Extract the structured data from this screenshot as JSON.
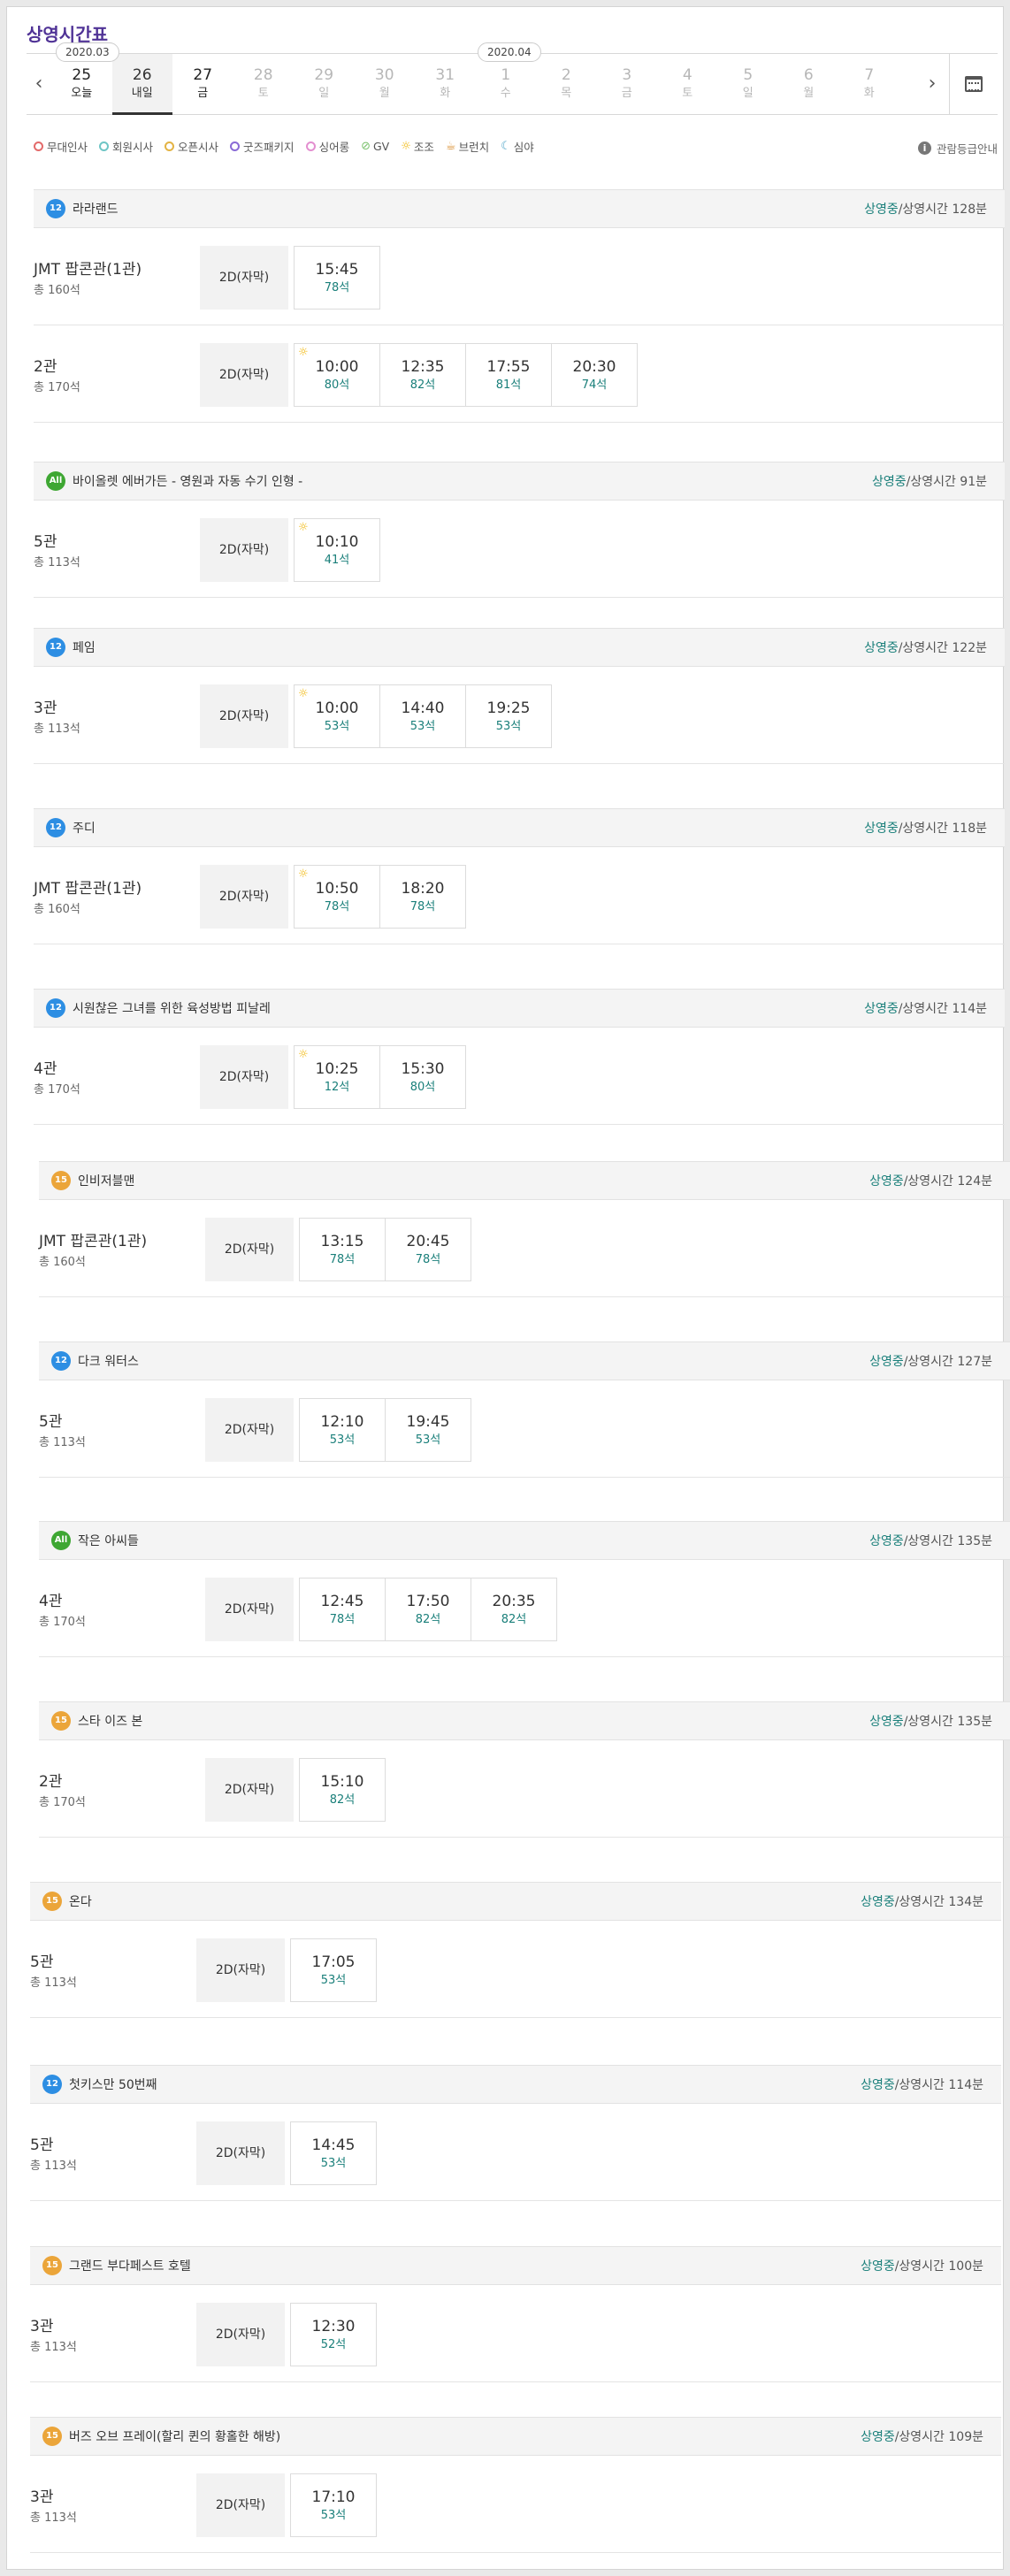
{
  "page_title": "상영시간표",
  "date_nav": {
    "prev_label": "‹",
    "next_label": "›",
    "month_tags": [
      "2020.03",
      "2020.04"
    ],
    "days": [
      {
        "num": "25",
        "weekday": "오늘",
        "state": "on"
      },
      {
        "num": "26",
        "weekday": "내일",
        "state": "sel"
      },
      {
        "num": "27",
        "weekday": "금",
        "state": "on"
      },
      {
        "num": "28",
        "weekday": "토",
        "state": "off"
      },
      {
        "num": "29",
        "weekday": "일",
        "state": "off"
      },
      {
        "num": "30",
        "weekday": "월",
        "state": "off"
      },
      {
        "num": "31",
        "weekday": "화",
        "state": "off"
      },
      {
        "num": "1",
        "weekday": "수",
        "state": "off"
      },
      {
        "num": "2",
        "weekday": "목",
        "state": "off"
      },
      {
        "num": "3",
        "weekday": "금",
        "state": "off"
      },
      {
        "num": "4",
        "weekday": "토",
        "state": "off"
      },
      {
        "num": "5",
        "weekday": "일",
        "state": "off"
      },
      {
        "num": "6",
        "weekday": "월",
        "state": "off"
      },
      {
        "num": "7",
        "weekday": "화",
        "state": "off"
      }
    ]
  },
  "legend": [
    {
      "label": "무대인사",
      "color": "#e36a6a",
      "kind": "dot"
    },
    {
      "label": "회원시사",
      "color": "#6ec5c5",
      "kind": "dot"
    },
    {
      "label": "오픈시사",
      "color": "#e3b343",
      "kind": "dot"
    },
    {
      "label": "굿즈패키지",
      "color": "#8a6bd6",
      "kind": "dot"
    },
    {
      "label": "싱어롱",
      "color": "#e38fd0",
      "kind": "dot"
    },
    {
      "label": "GV",
      "color": "#78c06a",
      "kind": "check"
    },
    {
      "label": "조조",
      "color": "#f0b400",
      "kind": "sun"
    },
    {
      "label": "브런치",
      "color": "#d98c2b",
      "kind": "cup"
    },
    {
      "label": "심야",
      "color": "#4ba3c7",
      "kind": "moon"
    }
  ],
  "rating_guide": "관람등급안내",
  "common": {
    "status": "상영중",
    "runtime_prefix": "/상영시간 "
  },
  "movies": [
    {
      "age": "12",
      "age_class": "a12",
      "title": "라라랜드",
      "runtime": "128분",
      "theaters": [
        {
          "name": "JMT 팝콘관(1관)",
          "seats": "총 160석",
          "type": "2D(자막)",
          "times": [
            {
              "t": "15:45",
              "s": "78석"
            }
          ]
        },
        {
          "name": "2관",
          "seats": "총 170석",
          "type": "2D(자막)",
          "times": [
            {
              "t": "10:00",
              "s": "80석",
              "early": true
            },
            {
              "t": "12:35",
              "s": "82석"
            },
            {
              "t": "17:55",
              "s": "81석"
            },
            {
              "t": "20:30",
              "s": "74석"
            }
          ]
        }
      ]
    },
    {
      "age": "All",
      "age_class": "aAll",
      "title": "바이올렛 에버가든 - 영원과 자동 수기 인형 -",
      "runtime": "91분",
      "theaters": [
        {
          "name": "5관",
          "seats": "총 113석",
          "type": "2D(자막)",
          "times": [
            {
              "t": "10:10",
              "s": "41석",
              "early": true
            }
          ]
        }
      ]
    },
    {
      "age": "12",
      "age_class": "a12",
      "title": "페임",
      "runtime": "122분",
      "theaters": [
        {
          "name": "3관",
          "seats": "총 113석",
          "type": "2D(자막)",
          "times": [
            {
              "t": "10:00",
              "s": "53석",
              "early": true
            },
            {
              "t": "14:40",
              "s": "53석"
            },
            {
              "t": "19:25",
              "s": "53석"
            }
          ]
        }
      ]
    },
    {
      "age": "12",
      "age_class": "a12",
      "title": "주디",
      "runtime": "118분",
      "theaters": [
        {
          "name": "JMT 팝콘관(1관)",
          "seats": "총 160석",
          "type": "2D(자막)",
          "times": [
            {
              "t": "10:50",
              "s": "78석",
              "early": true
            },
            {
              "t": "18:20",
              "s": "78석"
            }
          ]
        }
      ]
    },
    {
      "age": "12",
      "age_class": "a12",
      "title": "시원찮은 그녀를 위한 육성방법 피날레",
      "runtime": "114분",
      "theaters": [
        {
          "name": "4관",
          "seats": "총 170석",
          "type": "2D(자막)",
          "times": [
            {
              "t": "10:25",
              "s": "12석",
              "early": true
            },
            {
              "t": "15:30",
              "s": "80석"
            }
          ]
        }
      ]
    },
    {
      "age": "15",
      "age_class": "a15",
      "title": "인비저블맨",
      "runtime": "124분",
      "theaters": [
        {
          "name": "JMT 팝콘관(1관)",
          "seats": "총 160석",
          "type": "2D(자막)",
          "times": [
            {
              "t": "13:15",
              "s": "78석"
            },
            {
              "t": "20:45",
              "s": "78석"
            }
          ]
        }
      ]
    },
    {
      "age": "12",
      "age_class": "a12",
      "title": "다크 워터스",
      "runtime": "127분",
      "theaters": [
        {
          "name": "5관",
          "seats": "총 113석",
          "type": "2D(자막)",
          "times": [
            {
              "t": "12:10",
              "s": "53석"
            },
            {
              "t": "19:45",
              "s": "53석"
            }
          ]
        }
      ]
    },
    {
      "age": "All",
      "age_class": "aAll",
      "title": "작은 아씨들",
      "runtime": "135분",
      "theaters": [
        {
          "name": "4관",
          "seats": "총 170석",
          "type": "2D(자막)",
          "times": [
            {
              "t": "12:45",
              "s": "78석"
            },
            {
              "t": "17:50",
              "s": "82석"
            },
            {
              "t": "20:35",
              "s": "82석"
            }
          ]
        }
      ]
    },
    {
      "age": "15",
      "age_class": "a15",
      "title": "스타 이즈 본",
      "runtime": "135분",
      "theaters": [
        {
          "name": "2관",
          "seats": "총 170석",
          "type": "2D(자막)",
          "times": [
            {
              "t": "15:10",
              "s": "82석"
            }
          ]
        }
      ]
    },
    {
      "age": "15",
      "age_class": "a15",
      "title": "온다",
      "runtime": "134분",
      "theaters": [
        {
          "name": "5관",
          "seats": "총 113석",
          "type": "2D(자막)",
          "times": [
            {
              "t": "17:05",
              "s": "53석"
            }
          ]
        }
      ]
    },
    {
      "age": "12",
      "age_class": "a12",
      "title": "첫키스만 50번째",
      "runtime": "114분",
      "theaters": [
        {
          "name": "5관",
          "seats": "총 113석",
          "type": "2D(자막)",
          "times": [
            {
              "t": "14:45",
              "s": "53석"
            }
          ]
        }
      ]
    },
    {
      "age": "15",
      "age_class": "a15",
      "title": "그랜드 부다페스트 호텔",
      "runtime": "100분",
      "theaters": [
        {
          "name": "3관",
          "seats": "총 113석",
          "type": "2D(자막)",
          "times": [
            {
              "t": "12:30",
              "s": "52석"
            }
          ]
        }
      ]
    },
    {
      "age": "15",
      "age_class": "a15",
      "title": "버즈 오브 프레이(할리 퀸의 황홀한 해방)",
      "runtime": "109분",
      "theaters": [
        {
          "name": "3관",
          "seats": "총 113석",
          "type": "2D(자막)",
          "times": [
            {
              "t": "17:10",
              "s": "53석"
            }
          ]
        }
      ]
    }
  ]
}
